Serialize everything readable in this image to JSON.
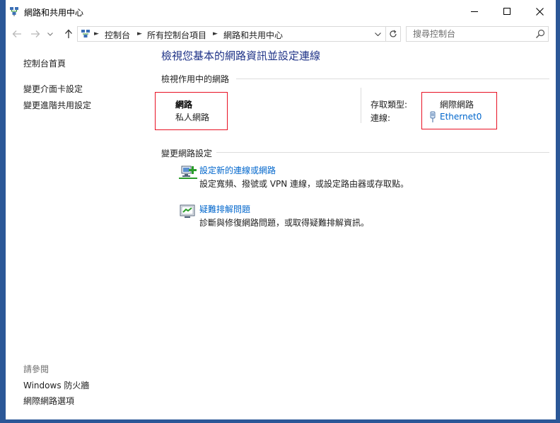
{
  "window": {
    "title": "網路和共用中心",
    "controls": {
      "minimize": "minimize-icon",
      "maximize": "maximize-icon",
      "close": "close-icon"
    }
  },
  "addressbar": {
    "breadcrumbs": [
      "控制台",
      "所有控制台項目",
      "網路和共用中心"
    ],
    "search_placeholder": "搜尋控制台"
  },
  "sidebar": {
    "home": "控制台首頁",
    "items": [
      "變更介面卡設定",
      "變更進階共用設定"
    ],
    "see_also_title": "請參閱",
    "see_also": [
      "Windows 防火牆",
      "網際網路選項"
    ]
  },
  "main": {
    "title": "檢視您基本的網路資訊並設定連線",
    "active_networks_heading": "檢視作用中的網路",
    "network": {
      "name": "網路",
      "category": "私人網路"
    },
    "access_type_label": "存取類型:",
    "access_type_value": "網際網路",
    "connections_label": "連線:",
    "connection_name": "Ethernet0",
    "change_heading": "變更網路設定",
    "tasks": [
      {
        "title": "設定新的連線或網路",
        "desc": "設定寬頻、撥號或 VPN 連線，或設定路由器或存取點。",
        "icon": "new-connection-icon"
      },
      {
        "title": "疑難排解問題",
        "desc": "診斷與修復網路問題，或取得疑難排解資訊。",
        "icon": "troubleshoot-icon"
      }
    ]
  },
  "colors": {
    "accent": "#2b5797",
    "link": "#0066cc",
    "title": "#1e3287",
    "highlight_box": "#e81123"
  }
}
